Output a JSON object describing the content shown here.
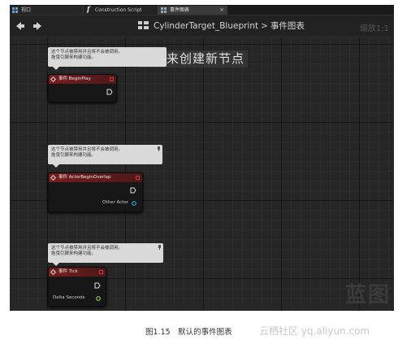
{
  "tabs": [
    {
      "label": "视口"
    },
    {
      "label": "Construction Script"
    },
    {
      "label": "事件图表",
      "close": "×"
    }
  ],
  "toolbar": {
    "blueprint_name": "CylinderTarget_Blueprint",
    "separator": ">",
    "current_graph": "事件图表",
    "zoom": "缩放1:1"
  },
  "graph": {
    "hint": "右击来创建新节点",
    "comments": [
      {
        "line1": "这个节点被禁用并且将不会被调用。",
        "line2": "拖曳引脚来构建功能。"
      },
      {
        "line1": "这个节点被禁用并且将不会被调用。",
        "line2": "拖曳引脚来构建功能。"
      },
      {
        "line1": "这个节点被禁用并且将不会被调用。",
        "line2": "拖曳引脚来构建功能。"
      }
    ],
    "nodes": [
      {
        "title": "事件 BeginPlay",
        "output": ""
      },
      {
        "title": "事件 ActorBeginOverlap",
        "output": "Other Actor"
      },
      {
        "title": "事件 Tick",
        "output": "Delta Seconds"
      }
    ],
    "watermark": "蓝图"
  },
  "caption": "图1.15　默认的事件图表",
  "site": "云栖社区 yq.aliyun.com",
  "colors": {
    "event_header": "#7a1c1c",
    "object_pin": "#2ea8e0",
    "float_pin": "#8bd442",
    "graph_bg": "#262626"
  }
}
